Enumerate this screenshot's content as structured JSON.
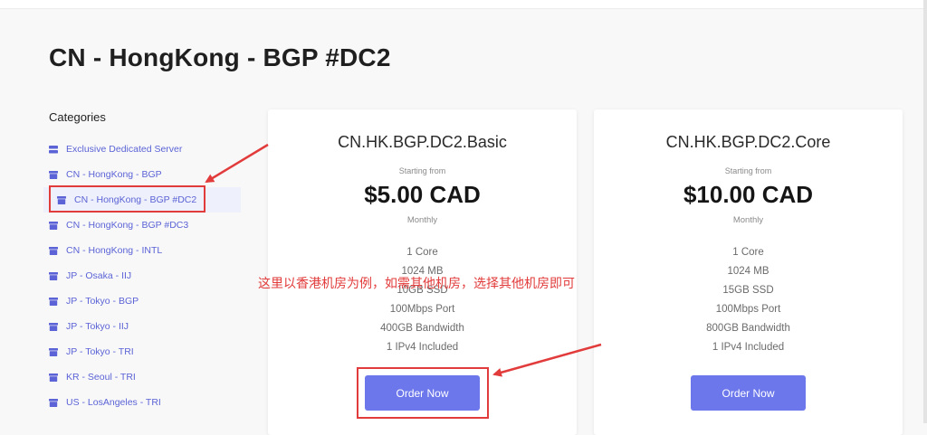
{
  "page": {
    "title": "CN - HongKong - BGP #DC2"
  },
  "sidebar": {
    "heading": "Categories",
    "items": [
      {
        "label": "Exclusive Dedicated Server",
        "icon": "server-icon"
      },
      {
        "label": "CN - HongKong - BGP",
        "icon": "box-icon"
      },
      {
        "label": "CN - HongKong - BGP #DC2",
        "icon": "box-icon",
        "active": true
      },
      {
        "label": "CN - HongKong - BGP #DC3",
        "icon": "box-icon"
      },
      {
        "label": "CN - HongKong - INTL",
        "icon": "box-icon"
      },
      {
        "label": "JP - Osaka - IIJ",
        "icon": "box-icon"
      },
      {
        "label": "JP - Tokyo - BGP",
        "icon": "box-icon"
      },
      {
        "label": "JP - Tokyo - IIJ",
        "icon": "box-icon"
      },
      {
        "label": "JP - Tokyo - TRI",
        "icon": "box-icon"
      },
      {
        "label": "KR - Seoul - TRI",
        "icon": "box-icon"
      },
      {
        "label": "US - LosAngeles - TRI",
        "icon": "box-icon"
      }
    ]
  },
  "products": [
    {
      "name": "CN.HK.BGP.DC2.Basic",
      "starting_label": "Starting from",
      "price": "$5.00 CAD",
      "cycle": "Monthly",
      "features": [
        "1 Core",
        "1024 MB",
        "10GB SSD",
        "100Mbps Port",
        "400GB Bandwidth",
        "1 IPv4 Included"
      ],
      "button": "Order Now"
    },
    {
      "name": "CN.HK.BGP.DC2.Core",
      "starting_label": "Starting from",
      "price": "$10.00 CAD",
      "cycle": "Monthly",
      "features": [
        "1 Core",
        "1024 MB",
        "15GB SSD",
        "100Mbps Port",
        "800GB Bandwidth",
        "1 IPv4 Included"
      ],
      "button": "Order Now"
    }
  ],
  "annotation": {
    "note": "这里以香港机房为例，如需其他机房，选择其他机房即可"
  },
  "colors": {
    "accent": "#6c77ec",
    "link": "#5b63d6",
    "annotation_red": "#e23b3b"
  }
}
